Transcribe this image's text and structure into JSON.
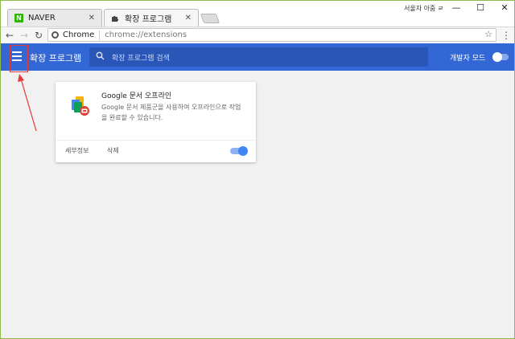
{
  "tabs": [
    {
      "label": "NAVER",
      "favicon": "naver-icon",
      "favicon_letter": "N",
      "active": false
    },
    {
      "label": "확장 프로그램",
      "favicon": "puzzle-icon",
      "active": true
    }
  ],
  "window": {
    "user_label": "서울자 아줌 ㄹ",
    "minimize": "—",
    "maximize": "☐",
    "close": "✕"
  },
  "toolbar": {
    "site_label": "Chrome",
    "url": "chrome://extensions"
  },
  "extensions_header": {
    "title": "확장 프로그램",
    "search_placeholder": "확장 프로그램 검색",
    "dev_mode_label": "개발자 모드",
    "dev_mode_on": false,
    "accent_color": "#3367d6"
  },
  "extension_card": {
    "name": "Google 문서 오프라인",
    "description": "Google 문서 제품군을 사용하여 오프라인으로 작업을 완료할 수 있습니다.",
    "details_label": "세부정보",
    "remove_label": "삭제",
    "enabled": true
  },
  "annotation": {
    "box_color": "#e53935",
    "arrow_color": "#e53935"
  }
}
